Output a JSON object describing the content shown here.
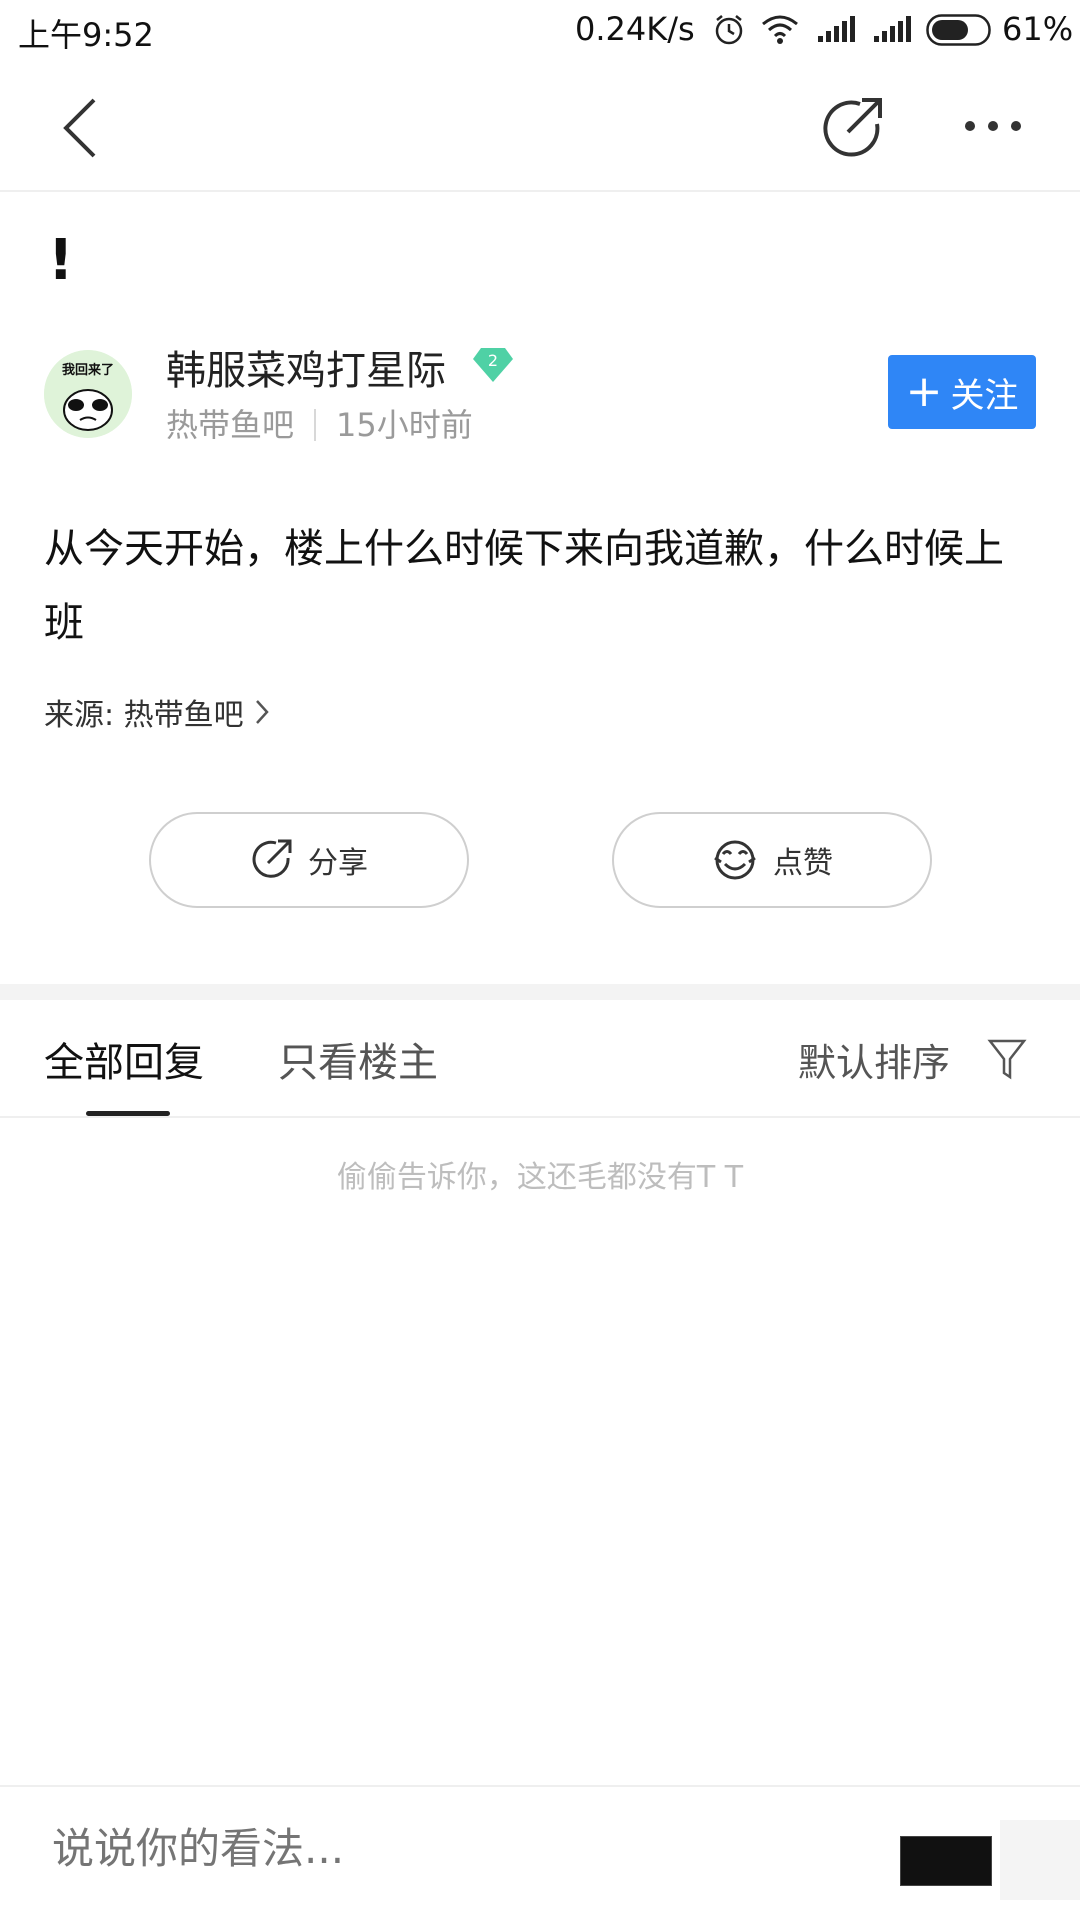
{
  "status_bar": {
    "time": "上午9:52",
    "speed": "0.24K/s",
    "battery_pct": "61%",
    "battery_level": 0.61,
    "icons": [
      "alarm-icon",
      "wifi-icon",
      "signal-icon",
      "signal-icon",
      "battery-icon"
    ]
  },
  "nav": {
    "icons": [
      "back-icon",
      "share-icon",
      "more-icon"
    ]
  },
  "post": {
    "title": "!",
    "author": {
      "name": "韩服菜鸡打星际",
      "level": "2",
      "avatar_caption": "我回来了"
    },
    "forum": "热带鱼吧",
    "time_ago": "15小时前",
    "follow_label": "关注",
    "body": "从今天开始，楼上什么时候下来向我道歉，什么时候上班",
    "source_label": "来源: 热带鱼吧"
  },
  "actions": {
    "share_label": "分享",
    "like_label": "点赞"
  },
  "tabs": {
    "all": "全部回复",
    "op_only": "只看楼主",
    "sort": "默认排序"
  },
  "empty_note": "偷偷告诉你，这还毛都没有T T",
  "comment": {
    "placeholder": "说说你的看法..."
  },
  "colors": {
    "accent": "#2f86f6",
    "level_badge": "#4fd1a5"
  }
}
